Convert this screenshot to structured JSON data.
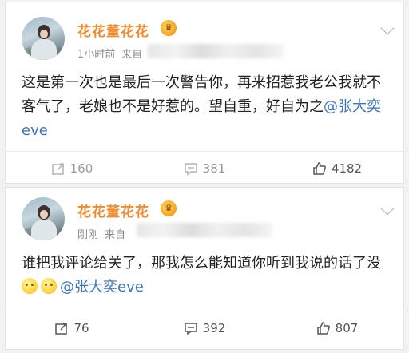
{
  "posts": [
    {
      "username": "花花董花花",
      "vip_badge": "♛",
      "time": "1小时前",
      "source_prefix": "来自",
      "text_before": "这是第一次也是最后一次警告你，再来招惹我老公我就不客气了，老娘也不是好惹的。望自重，好自为之",
      "mention": "@张大奕eve",
      "emojis": [],
      "actions": {
        "repost": "160",
        "comment": "381",
        "like": "4182"
      },
      "icons": {
        "menu": "chevron-down-icon",
        "repost": "repost-icon",
        "comment": "comment-icon",
        "like": "thumbs-up-icon"
      }
    },
    {
      "username": "花花董花花",
      "vip_badge": "♛",
      "time": "刚刚",
      "source_prefix": "来自",
      "text_before": "谁把我评论给关了，那我怎么能知道你听到我说的话了没",
      "mention": "@张大奕eve",
      "emojis": [
        "smile-emoji",
        "smile-emoji"
      ],
      "actions": {
        "repost": "76",
        "comment": "392",
        "like": "807"
      },
      "icons": {
        "menu": "chevron-down-icon",
        "repost": "repost-icon",
        "comment": "comment-icon",
        "like": "thumbs-up-icon"
      }
    }
  ],
  "colors": {
    "username": "#f08c30",
    "mention": "#3e74b8",
    "text": "#222222",
    "meta": "#8a8a8a"
  }
}
